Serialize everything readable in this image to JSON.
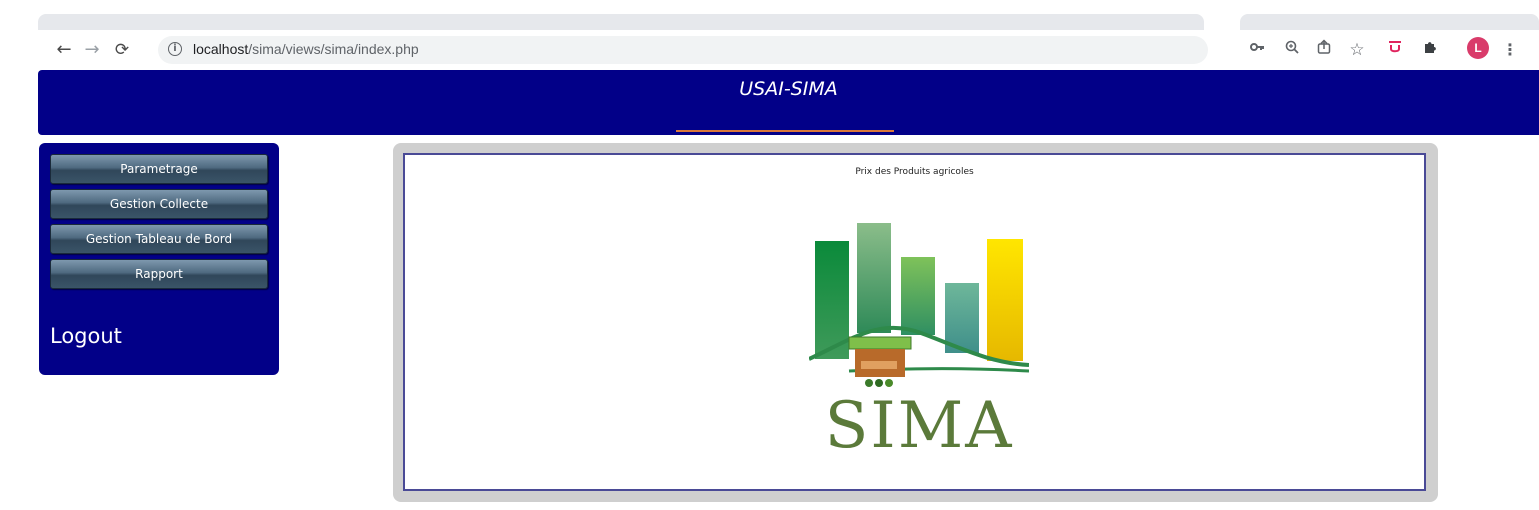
{
  "browser": {
    "url_host": "localhost",
    "url_path": "/sima/views/sima/index.php",
    "avatar_letter": "L",
    "icons": [
      "back-icon",
      "forward-icon",
      "reload-icon",
      "info-icon",
      "key-icon",
      "zoom-icon",
      "share-icon",
      "star-icon",
      "extension-shield-icon",
      "puzzle-icon",
      "menu-dots-icon"
    ]
  },
  "header": {
    "title": "USAI-SIMA"
  },
  "sidebar": {
    "items": [
      {
        "label": "Parametrage"
      },
      {
        "label": "Gestion Collecte"
      },
      {
        "label": "Gestion Tableau de Bord"
      },
      {
        "label": "Rapport"
      }
    ],
    "logout_label": "Logout"
  },
  "main": {
    "caption": "Prix des Produits agricoles",
    "logo_text": "SIMA"
  },
  "colors": {
    "header_bg": "#020088",
    "accent_line": "#d9773a",
    "panel_border": "#4a4a96",
    "logo_green": "#5b7a3a"
  }
}
